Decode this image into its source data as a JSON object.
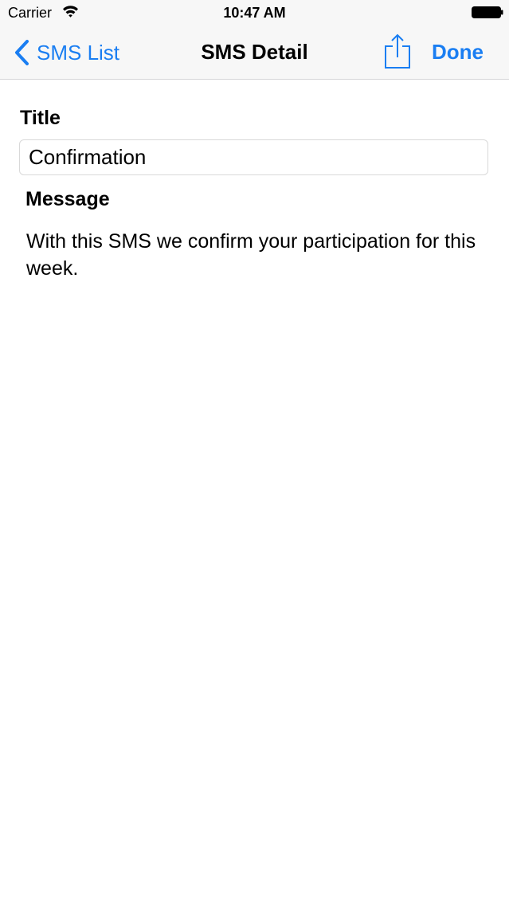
{
  "status_bar": {
    "carrier": "Carrier",
    "time": "10:47 AM",
    "wifi_icon": "wifi-icon",
    "battery_icon": "battery-full-icon"
  },
  "nav": {
    "back_label": "SMS List",
    "back_icon": "chevron-left-icon",
    "title": "SMS Detail",
    "share_icon": "share-icon",
    "done_label": "Done",
    "tint_color": "#1a7ef2"
  },
  "form": {
    "title_label": "Title",
    "title_value": "Confirmation",
    "message_label": "Message",
    "message_text": "With this SMS we confirm your participation for this week."
  }
}
